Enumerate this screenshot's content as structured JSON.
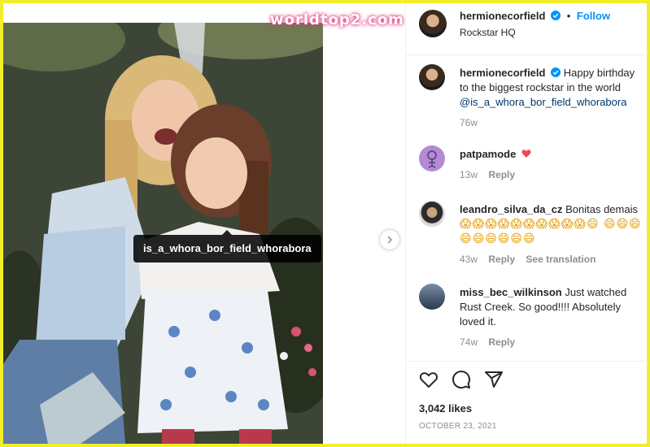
{
  "watermark": "worldtop2.com",
  "photo": {
    "tag_username": "is_a_whora_bor_field_whorabora"
  },
  "post": {
    "author": "hermionecorfield",
    "follow_label": "Follow",
    "location": "Rockstar HQ",
    "separator": "•"
  },
  "comments": [
    {
      "username": "hermionecorfield",
      "text": "Happy birthday to the biggest rockstar in the world",
      "mention": "@is_a_whora_bor_field_whorabora",
      "time": "76w"
    },
    {
      "username": "patpamode",
      "text": "",
      "time": "13w",
      "reply": "Reply"
    },
    {
      "username": "leandro_silva_da_cz",
      "text": "Bonitas demais",
      "emojis": "😱😱😱😱😱😱😱😱😱😱😄 😄😄😄😄😄😄😄😄😄",
      "time": "43w",
      "reply": "Reply",
      "translate": "See translation"
    },
    {
      "username": "miss_bec_wilkinson",
      "text": "Just watched Rust Creek. So good!!!! Absolutely loved it.",
      "time": "74w",
      "reply": "Reply"
    }
  ],
  "actions": {
    "likes": "3,042 likes",
    "date": "OCTOBER 23, 2021"
  },
  "colors": {
    "accent": "#0095f6",
    "border": "#f3ee2a",
    "heart": "#ed4956"
  }
}
